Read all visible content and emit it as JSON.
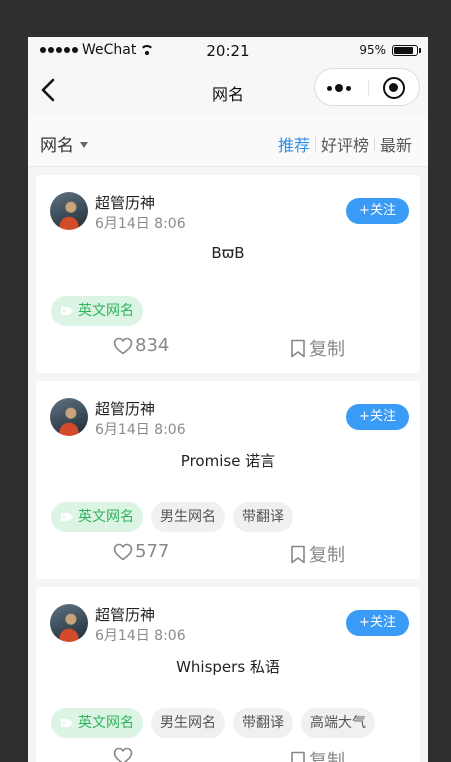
{
  "status_bar": {
    "carrier": "WeChat",
    "time": "20:21",
    "battery": "95%",
    "battery_level": 0.95
  },
  "nav": {
    "title": "网名"
  },
  "filter": {
    "category": "网名",
    "sorts": [
      {
        "label": "推荐",
        "active": true
      },
      {
        "label": "好评榜",
        "active": false
      },
      {
        "label": "最新",
        "active": false
      }
    ]
  },
  "colors": {
    "accent": "#2e8ee8",
    "follow_bg": "#3a9bf7",
    "tag_green_bg": "#dcf4e4",
    "tag_green_text": "#2fb35c"
  },
  "cards": [
    {
      "author": "超管历神",
      "date": "6月14日 8:06",
      "follow_label": "+关注",
      "nickname": "BϖB",
      "tags": [
        {
          "label": "英文网名",
          "primary": true
        }
      ],
      "likes": "834",
      "copy_label": "复制"
    },
    {
      "author": "超管历神",
      "date": "6月14日 8:06",
      "follow_label": "+关注",
      "nickname": "Promise 诺言",
      "tags": [
        {
          "label": "英文网名",
          "primary": true
        },
        {
          "label": "男生网名",
          "primary": false
        },
        {
          "label": "带翻译",
          "primary": false
        }
      ],
      "likes": "577",
      "copy_label": "复制"
    },
    {
      "author": "超管历神",
      "date": "6月14日 8:06",
      "follow_label": "+关注",
      "nickname": "Whispers 私语",
      "tags": [
        {
          "label": "英文网名",
          "primary": true
        },
        {
          "label": "男生网名",
          "primary": false
        },
        {
          "label": "带翻译",
          "primary": false
        },
        {
          "label": "高端大气",
          "primary": false
        }
      ],
      "likes": "",
      "copy_label": "复制"
    }
  ]
}
